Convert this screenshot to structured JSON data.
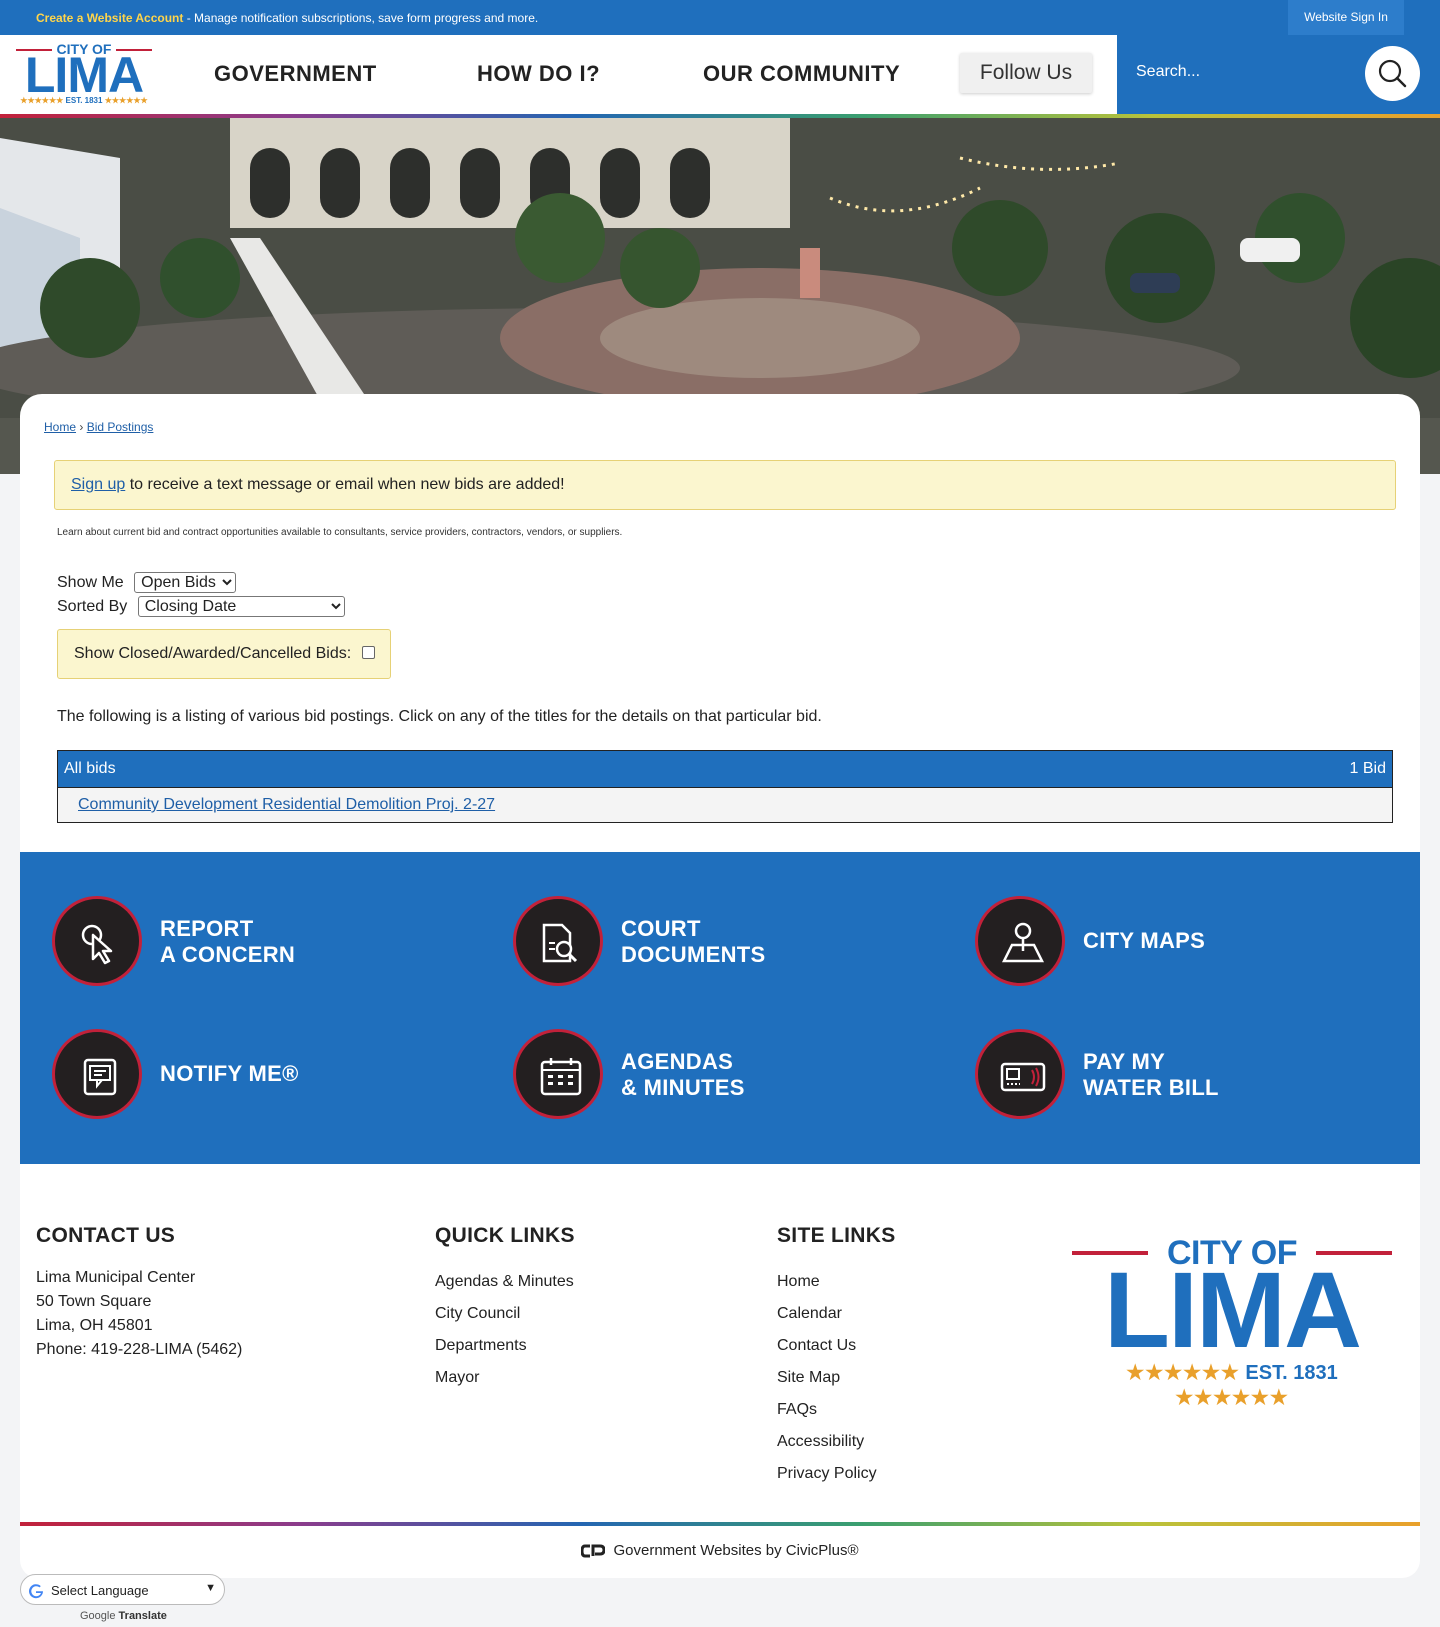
{
  "topbar": {
    "create_link": "Create a Website Account",
    "create_desc": " - Manage notification subscriptions, save form progress and more.",
    "sign_in": "Website Sign In"
  },
  "logo": {
    "city_of": "CITY OF",
    "lima": "LIMA",
    "est": "EST. 1831",
    "stars": "★★★★★★"
  },
  "nav": {
    "items": [
      "GOVERNMENT",
      "HOW DO I?",
      "OUR COMMUNITY"
    ],
    "follow": "Follow Us",
    "search_placeholder": "Search..."
  },
  "breadcrumb": {
    "home": "Home",
    "sep": "›",
    "current": "Bid Postings"
  },
  "alert": {
    "link": "Sign up",
    "text": " to receive a text message or email when new bids are added!"
  },
  "intro": "Learn about current bid and contract opportunities available to consultants, service providers, contractors, vendors, or suppliers.",
  "filters": {
    "show_me_label": "Show Me",
    "show_me_value": "Open Bids",
    "sorted_by_label": "Sorted By",
    "sorted_by_value": "Closing Date",
    "show_closed_label": "Show Closed/Awarded/Cancelled Bids:"
  },
  "listing_text": "The following is a listing of various bid postings. Click on any of the titles for the details on that particular bid.",
  "bids": {
    "header": "All bids",
    "count": "1 Bid",
    "items": [
      "Community Development Residential Demolition Proj. 2-27"
    ]
  },
  "quick_links": [
    {
      "line1": "REPORT",
      "line2": "A CONCERN",
      "icon": "pointer-icon"
    },
    {
      "line1": "COURT",
      "line2": "DOCUMENTS",
      "icon": "document-search-icon"
    },
    {
      "line1": "CITY MAPS",
      "line2": "",
      "icon": "map-pin-icon"
    },
    {
      "line1": "NOTIFY ME®",
      "line2": "",
      "icon": "notify-icon"
    },
    {
      "line1": "AGENDAS",
      "line2": "& MINUTES",
      "icon": "calendar-icon"
    },
    {
      "line1": "PAY MY",
      "line2": "WATER BILL",
      "icon": "bill-icon"
    }
  ],
  "footer": {
    "contact": {
      "title": "CONTACT US",
      "lines": [
        "Lima Municipal Center",
        "50 Town Square",
        "Lima, OH 45801",
        "Phone: 419-228-LIMA (5462)"
      ]
    },
    "quick": {
      "title": "QUICK LINKS",
      "links": [
        "Agendas & Minutes",
        "City Council",
        "Departments",
        "Mayor"
      ]
    },
    "site": {
      "title": "SITE LINKS",
      "links": [
        "Home",
        "Calendar",
        "Contact Us",
        "Site Map",
        "FAQs",
        "Accessibility",
        "Privacy Policy"
      ]
    },
    "civic": "Government Websites by CivicPlus®"
  },
  "translate": {
    "select": "Select Language",
    "powered_google": "Google",
    "powered_translate": "Translate"
  },
  "colors": {
    "brand_blue": "#1f6fbd",
    "accent_red": "#c2213a",
    "star_gold": "#e9a02b"
  }
}
